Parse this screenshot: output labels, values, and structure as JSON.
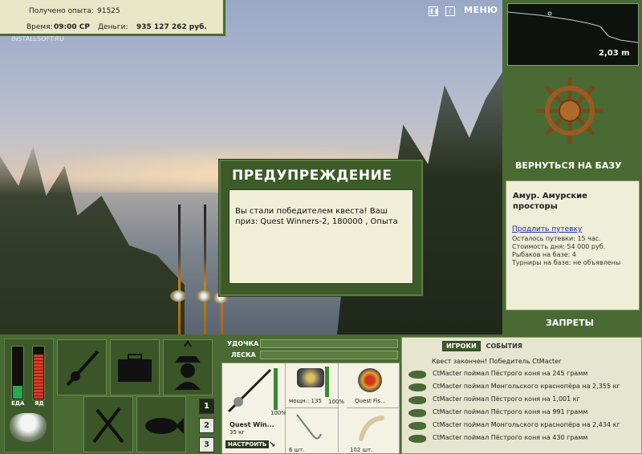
{
  "stats": {
    "experience_label": "Получено опыта:",
    "experience_value": "91525",
    "time_label": "Время:",
    "time_value": "09:00 СР",
    "money_label": "Деньги:",
    "money_value": "935 127 262 руб."
  },
  "watermark": "INSTALLSOFT.RU",
  "top_menu": {
    "pause_icon": "pause-icon",
    "sound_icon": "sound-icon",
    "menu_label": "МЕНЮ"
  },
  "depth_panel": {
    "depth_value": "2,03 m"
  },
  "right_panel": {
    "back_to_base": "ВЕРНУТЬСЯ НА БАЗУ",
    "location_title": "Амур. Амурские просторы",
    "extend_permit": "Продлить путевку",
    "permit_left": "Осталось путевки: 15 час.",
    "day_cost": "Стоимость дня: 54 000 руб.",
    "anglers": "Рыбаков на базе: 4",
    "tournaments": "Турниры на базе: не объявлены",
    "bans": "ЗАПРЕТЫ"
  },
  "dialog": {
    "title": "ПРЕДУПРЕЖДЕНИЕ",
    "message": "Вы стали победителем квеста! Ваш приз: Quest Winners-2, 180000 , Опыта"
  },
  "meters": {
    "food_label": "ЕДА",
    "poison_label": "ЯД",
    "food_level": 0.25,
    "poison_level": 0.85
  },
  "slots": {
    "active": "1",
    "numbers": [
      "1",
      "2",
      "3"
    ]
  },
  "tackle": {
    "rod_label": "УДОЧКА",
    "line_label": "ЛЕСКА",
    "rod_name": "Quest Win...",
    "rod_weight": "35 кг",
    "rod_percent": "100%",
    "setup_button": "НАСТРОИТЬ",
    "reel_power": "мощн.: 135",
    "reel_percent": "100%",
    "line_name": "Quest Fis...",
    "hook_count": "6 шт.",
    "bait_count": "102 шт."
  },
  "log": {
    "tab_players": "ИГРОКИ",
    "tab_events": "СОБЫТИЯ",
    "header": "Квест закончен! Победитель CtMacter",
    "entries": [
      "CtMacter поймал Пёстрого коня на 245 грамм",
      "CtMacter поймал Монгольского краснопёра на 2,355 кг",
      "CtMacter поймал Пёстрого коня на 1,001 кг",
      "CtMacter поймал Пёстрого коня на 991 грамм",
      "CtMacter поймал Монгольского краснопёра на 2,434 кг",
      "CtMacter поймал Пёстрого коня на 430 грамм"
    ]
  },
  "colors": {
    "panel_green": "#4a6a33",
    "panel_cream": "#efeed8",
    "link_blue": "#1a2ab0"
  }
}
